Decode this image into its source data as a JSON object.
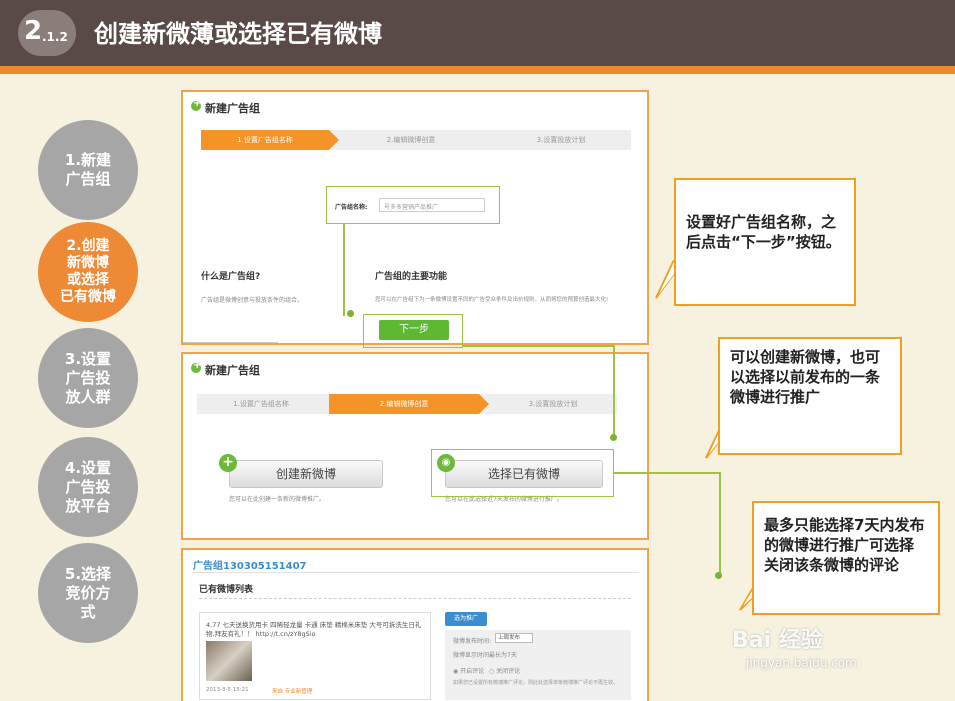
{
  "header": {
    "section_big": "2",
    "section_small": ".1.2",
    "title": "创建新微薄或选择已有微博"
  },
  "steps": [
    {
      "lines": [
        "1.新建",
        "广告组"
      ],
      "active": false
    },
    {
      "lines": [
        "2.创建",
        "新微博",
        "或选择",
        "已有微博"
      ],
      "active": true
    },
    {
      "lines": [
        "3.设置",
        "广告投",
        "放人群"
      ],
      "active": false
    },
    {
      "lines": [
        "4.设置",
        "广告投",
        "放平台"
      ],
      "active": false
    },
    {
      "lines": [
        "5.选择",
        "竞价方",
        "式"
      ],
      "active": false
    }
  ],
  "panel1": {
    "title": "新建广告组",
    "wizard": [
      "1.设置广告组名称",
      "2.编辑微博创意",
      "3.设置投放计划"
    ],
    "field_label": "广告组名称:",
    "field_value": "号多多营销产品推广",
    "what_title": "什么是广告组?",
    "what_text": "广告组是微博创意与投放条件的组合。",
    "func_title": "广告组的主要功能",
    "func_text": "您可以在广告组下为一条微博设置不同的广告受众条件及出价规则，从而将您的预算创造最大化!",
    "next_button": "下一步"
  },
  "panel2": {
    "title": "新建广告组",
    "wizard": [
      "1.设置广告组名称",
      "2.编辑微博创意",
      "3.设置投放计划"
    ],
    "create_button": "创建新微博",
    "create_hint": "您可以在此创建一条新的微博推广。",
    "select_button": "选择已有微博",
    "select_hint": "您可以在此选择近7天发布的微博进行推广。"
  },
  "panel3": {
    "group_name": "广告组130305151407",
    "list_title": "已有微博列表",
    "post_text": "4.77 七天送换货用卡 四稀轻龙量 卡通 床垫 精棉米床垫 大号可拆洗生日礼物,拜友有礼！！ http://t.cn/zY8gSio",
    "post_meta": "2013-3-5 15:21",
    "post_meta2": "来自 专业新管理",
    "promote_button": "选为推广",
    "opt_label": "微博发布时间:",
    "opt_select": "上周发布",
    "opt_text": "微博显示时间最长为7天",
    "radio_open": "开启评论",
    "radio_close": "关闭评论",
    "opt_note": "如果您已设置所有微博推广评论，则此处选择单条微博推广评论不再生效。"
  },
  "callouts": {
    "c1": "设置好广告组名称，之后点击“下一步”按钮。",
    "c2": "可以创建新微博，也可以选择以前发布的一条微博进行推广",
    "c3": "最多只能选择7天内发布的微博进行推广可选择关闭该条微博的评论"
  },
  "watermark": {
    "brand": "Bai 经验",
    "url": "jingyan.baidu.com"
  },
  "colors": {
    "title_bar": "#5a4a47",
    "accent_orange": "#ee8a35",
    "step_grey": "#a6a6a6",
    "highlight_green": "#9ac544",
    "button_green": "#5fb832"
  }
}
